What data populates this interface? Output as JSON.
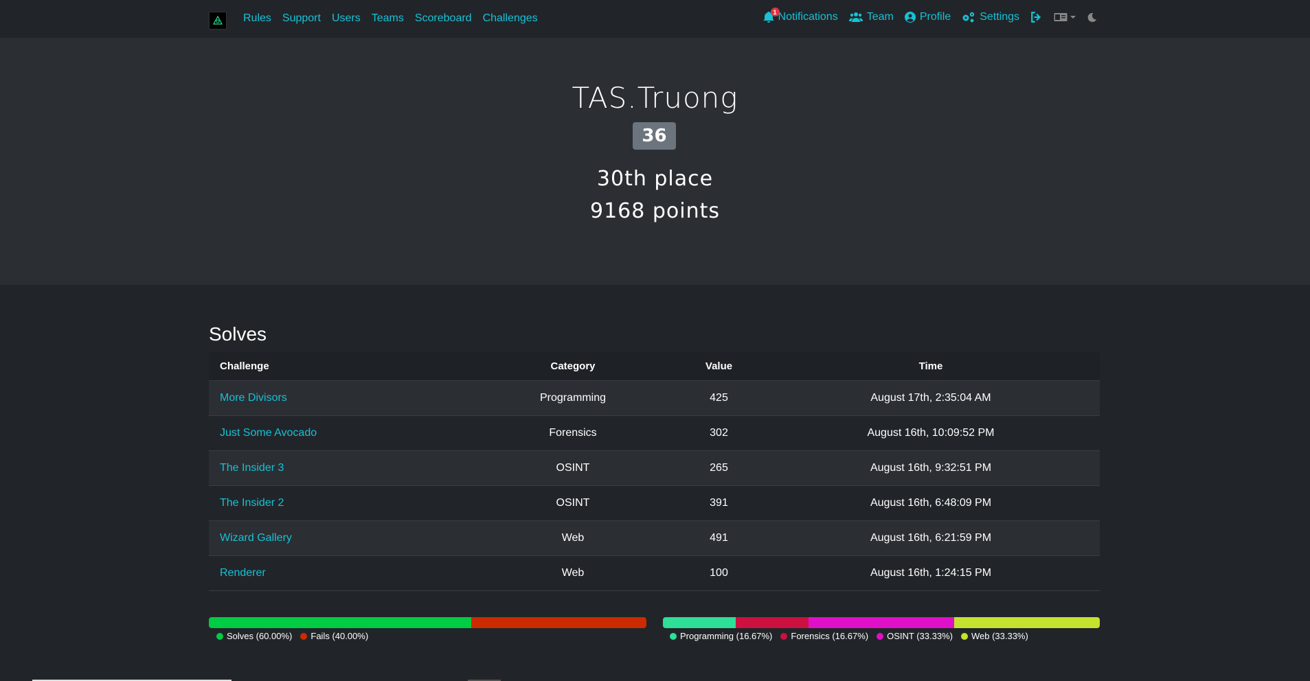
{
  "nav": {
    "left": [
      "Rules",
      "Support",
      "Users",
      "Teams",
      "Scoreboard",
      "Challenges"
    ],
    "notifications_label": "Notifications",
    "notifications_count": "1",
    "team_label": "Team",
    "profile_label": "Profile",
    "settings_label": "Settings"
  },
  "user": {
    "name": "TAS.Truong",
    "badge": "36",
    "place": "30th place",
    "points": "9168 points"
  },
  "solves": {
    "title": "Solves",
    "headers": [
      "Challenge",
      "Category",
      "Value",
      "Time"
    ],
    "rows": [
      {
        "challenge": "More Divisors",
        "category": "Programming",
        "value": "425",
        "time": "August 17th, 2:35:04 AM"
      },
      {
        "challenge": "Just Some Avocado",
        "category": "Forensics",
        "value": "302",
        "time": "August 16th, 10:09:52 PM"
      },
      {
        "challenge": "The Insider 3",
        "category": "OSINT",
        "value": "265",
        "time": "August 16th, 9:32:51 PM"
      },
      {
        "challenge": "The Insider 2",
        "category": "OSINT",
        "value": "391",
        "time": "August 16th, 6:48:09 PM"
      },
      {
        "challenge": "Wizard Gallery",
        "category": "Web",
        "value": "491",
        "time": "August 16th, 6:21:59 PM"
      },
      {
        "challenge": "Renderer",
        "category": "Web",
        "value": "100",
        "time": "August 16th, 1:24:15 PM"
      }
    ]
  },
  "charts": {
    "solve_fail": [
      {
        "label": "Solves (60.00%)",
        "fraction": 0.6,
        "color": "#00cc44"
      },
      {
        "label": "Fails (40.00%)",
        "fraction": 0.4,
        "color": "#cc2a00"
      }
    ],
    "categories": [
      {
        "label": "Programming (16.67%)",
        "fraction": 0.1667,
        "color": "#2ddf97"
      },
      {
        "label": "Forensics (16.67%)",
        "fraction": 0.1667,
        "color": "#cc1040"
      },
      {
        "label": "OSINT (33.33%)",
        "fraction": 0.3333,
        "color": "#e010c8"
      },
      {
        "label": "Web (33.33%)",
        "fraction": 0.3333,
        "color": "#c4e22e"
      }
    ]
  },
  "colors": {
    "accent": "#17c1d6",
    "badge_bg": "#6c757d",
    "notification_badge": "#dc3545"
  }
}
